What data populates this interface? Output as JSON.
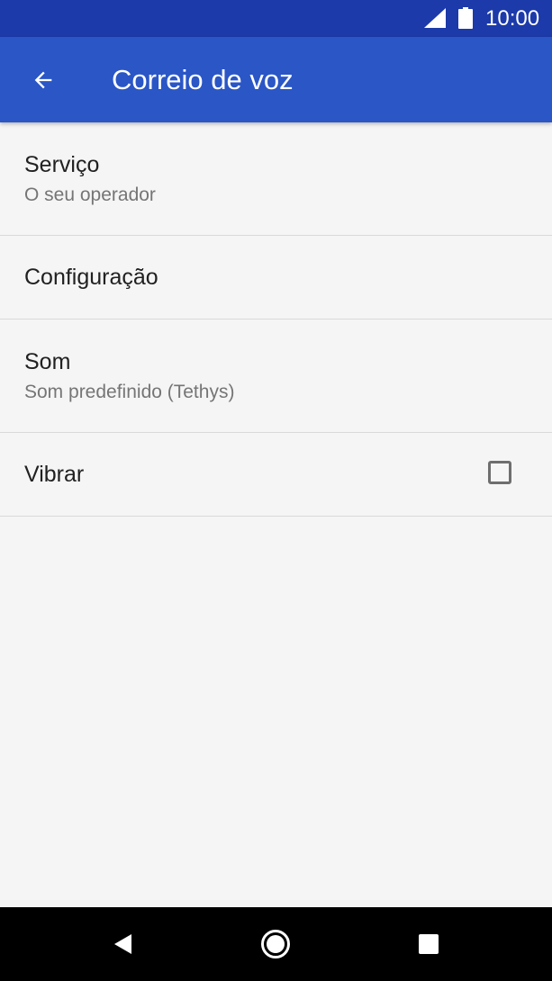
{
  "status_bar": {
    "time": "10:00",
    "icons": [
      "signal-icon",
      "battery-icon"
    ]
  },
  "app_bar": {
    "back_icon": "arrow-back-icon",
    "title": "Correio de voz",
    "color": "#2a56c6"
  },
  "settings": {
    "items": [
      {
        "title": "Serviço",
        "summary": "O seu operador"
      },
      {
        "title": "Configuração"
      },
      {
        "title": "Som",
        "summary": "Som predefinido (Tethys)"
      },
      {
        "title": "Vibrar",
        "checked": false
      }
    ]
  },
  "nav_bar": {
    "icons": [
      "back-triangle-icon",
      "home-circle-icon",
      "recents-square-icon"
    ]
  }
}
